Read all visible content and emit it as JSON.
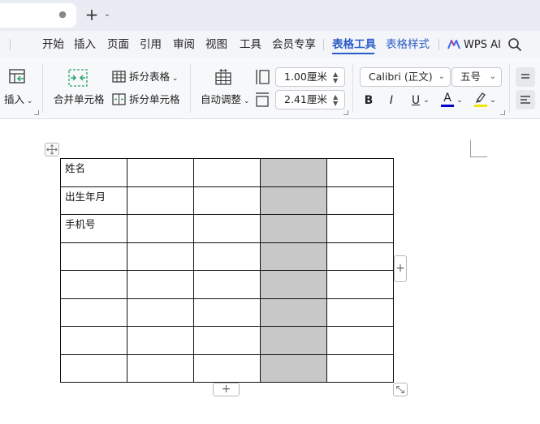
{
  "titlebar": {
    "close_glyph": "●",
    "new_tab_glyph": "+",
    "tab_list_glyph": "⌄"
  },
  "menu": {
    "items": [
      "开始",
      "插入",
      "页面",
      "引用",
      "审阅",
      "视图",
      "工具",
      "会员专享"
    ],
    "active_tab": "表格工具",
    "secondary_tab": "表格样式",
    "wps_ai": "WPS AI",
    "accent_color": "#2b5cc8"
  },
  "ribbon": {
    "insert_label": "插入",
    "merge_cells_label": "合并单元格",
    "split_table_label": "拆分表格",
    "split_cells_label": "拆分单元格",
    "auto_adjust_label": "自动调整",
    "row_height_value": "1.00厘米",
    "column_width_value": "2.41厘米",
    "font_name": "Calibri (正文)",
    "font_size": "五号",
    "bold_label": "B",
    "italic_label": "I",
    "underline_label": "U",
    "font_color_label": "A",
    "font_color": "#0000cc",
    "highlight_color": "#f2e600"
  },
  "table": {
    "rows": [
      [
        "姓名",
        "",
        "",
        "",
        ""
      ],
      [
        "出生年月",
        "",
        "",
        "",
        ""
      ],
      [
        "手机号",
        "",
        "",
        "",
        ""
      ],
      [
        "",
        "",
        "",
        "",
        ""
      ],
      [
        "",
        "",
        "",
        "",
        ""
      ],
      [
        "",
        "",
        "",
        "",
        ""
      ],
      [
        "",
        "",
        "",
        "",
        ""
      ],
      [
        "",
        "",
        "",
        "",
        ""
      ]
    ],
    "selected_column": 3,
    "selection_color": "#c8c8c8",
    "add_glyph": "+"
  }
}
